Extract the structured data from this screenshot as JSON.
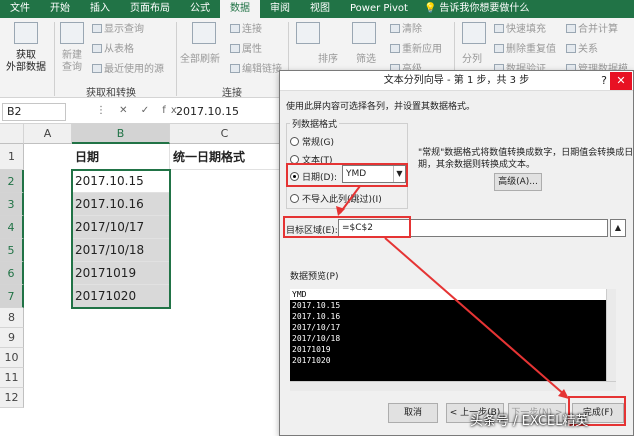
{
  "tabs": [
    "文件",
    "开始",
    "插入",
    "页面布局",
    "公式",
    "数据",
    "审阅",
    "视图",
    "Power Pivot"
  ],
  "active_tab_index": 5,
  "tell_me": "告诉我你想要做什么",
  "ribbon": {
    "get_external": "获取\n外部数据",
    "new_query": "新建\n查询",
    "show_query": "显示查询",
    "from_table": "从表格",
    "recent_sources": "最近使用的源",
    "group_get_transform": "获取和转换",
    "refresh_all": "全部刷新",
    "connections": "连接",
    "properties": "属性",
    "edit_links": "编辑链接",
    "group_connections": "连接",
    "sort": "排序",
    "filter": "筛选",
    "clear": "清除",
    "reapply": "重新应用",
    "advanced": "高级",
    "split": "分列",
    "flash_fill": "快速填充",
    "remove_duplicates": "删除重复值",
    "data_validation": "数据验证",
    "consolidate": "合并计算",
    "relationships": "关系",
    "manage_model": "管理数据模"
  },
  "formula_bar": {
    "name_box": "B2",
    "icons": "⋮ ✕ ✓ fx",
    "value": "2017.10.15"
  },
  "sheet": {
    "columns": [
      "A",
      "B",
      "C"
    ],
    "rows": [
      "1",
      "2",
      "3",
      "4",
      "5",
      "6",
      "7",
      "8",
      "9",
      "10",
      "11",
      "12"
    ],
    "b1": "日期",
    "c1": "统一日期格式",
    "dates": [
      "2017.10.15",
      "2017.10.16",
      "2017/10/17",
      "2017/10/18",
      "20171019",
      "20171020"
    ]
  },
  "dialog": {
    "title": "文本分列向导 - 第 1 步，共 3 步",
    "help": "?",
    "close": "✕",
    "instruction": "使用此屏内容可选择各列，并设置其数据格式。",
    "group_label": "列数据格式",
    "opt_general": "常规(G)",
    "opt_text": "文本(T)",
    "opt_date": "日期(D):",
    "date_format": "YMD",
    "opt_skip": "不导入此列(跳过)(I)",
    "desc_line1": "\"常规\"数据格式将数值转换成数字，日期值会转换成日",
    "desc_line2": "期，其余数据则转换成文本。",
    "advanced_btn": "高级(A)...",
    "dest_label": "目标区域(E):",
    "dest_value": "=$C$2",
    "preview_label": "数据预览(P)",
    "preview_header": "YMD",
    "preview_rows": [
      "2017.10.15",
      "2017.10.16",
      "2017/10/17",
      "2017/10/18",
      "20171019",
      "20171020"
    ],
    "btn_cancel": "取消",
    "btn_back": "< 上一步(B)",
    "btn_next": "下一步(N) >",
    "btn_finish": "完成(F)"
  },
  "annotation_color": "#e53434",
  "watermark": "头条号 / EXCEL精英"
}
